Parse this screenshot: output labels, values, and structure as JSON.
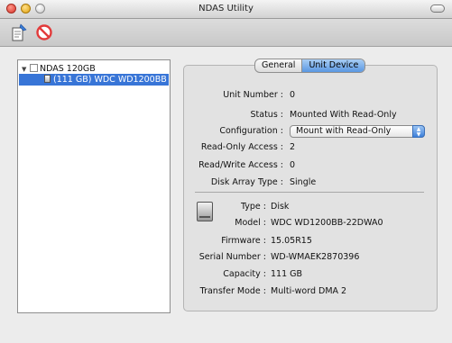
{
  "window": {
    "title": "NDAS Utility"
  },
  "toolbar": {
    "properties_icon": "properties-icon",
    "remove_icon": "no-entry-icon"
  },
  "tree": {
    "root": {
      "label": "NDAS 120GB"
    },
    "child": {
      "label": "(111 GB) WDC WD1200BB"
    }
  },
  "tabs": {
    "general": "General",
    "unit_device": "Unit Device",
    "active": "Unit Device"
  },
  "details": {
    "unit_number": {
      "label": "Unit Number :",
      "value": "0"
    },
    "status": {
      "label": "Status :",
      "value": "Mounted With Read-Only"
    },
    "configuration": {
      "label": "Configuration :",
      "value": "Mount with Read-Only"
    },
    "ro_access": {
      "label": "Read-Only Access :",
      "value": "2"
    },
    "rw_access": {
      "label": "Read/Write Access :",
      "value": "0"
    },
    "disk_array": {
      "label": "Disk Array Type :",
      "value": "Single"
    }
  },
  "device": {
    "icon": "hard-disk-icon",
    "type": {
      "label": "Type :",
      "value": "Disk"
    },
    "model": {
      "label": "Model :",
      "value": "WDC WD1200BB-22DWA0"
    },
    "firmware": {
      "label": "Firmware :",
      "value": "15.05R15"
    },
    "serial": {
      "label": "Serial Number :",
      "value": "WD-WMAEK2870396"
    },
    "capacity": {
      "label": "Capacity :",
      "value": "111 GB"
    },
    "transfer_mode": {
      "label": "Transfer Mode :",
      "value": "Multi-word DMA 2"
    }
  },
  "colors": {
    "selection": "#3875d7",
    "tab_active": "#5a97e2"
  }
}
